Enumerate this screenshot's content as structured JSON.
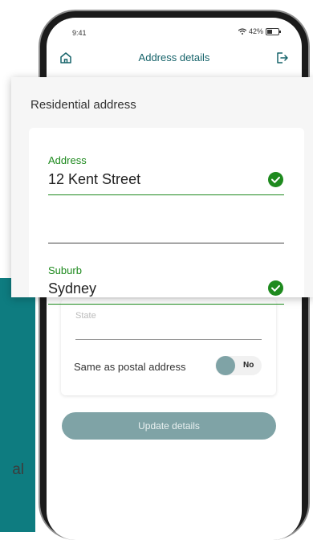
{
  "side_text": "al",
  "status_bar": {
    "time": "9:41",
    "battery": "42%"
  },
  "header": {
    "title": "Address details"
  },
  "form": {
    "section_title": "Residential address",
    "address": {
      "label": "Address",
      "value": "12 Kent Street"
    },
    "address_line2": {
      "value": ""
    },
    "suburb": {
      "label": "Suburb",
      "value": "Sydney"
    },
    "state": {
      "label": "State"
    },
    "same_as_postal": {
      "label": "Same as postal address",
      "toggle_text": "No",
      "enabled": false
    }
  },
  "actions": {
    "update_label": "Update details"
  },
  "colors": {
    "teal": "#0e7c80",
    "header_teal": "#16636a",
    "success_green": "#1e8a1e",
    "button_disabled": "#7fa3a6"
  }
}
